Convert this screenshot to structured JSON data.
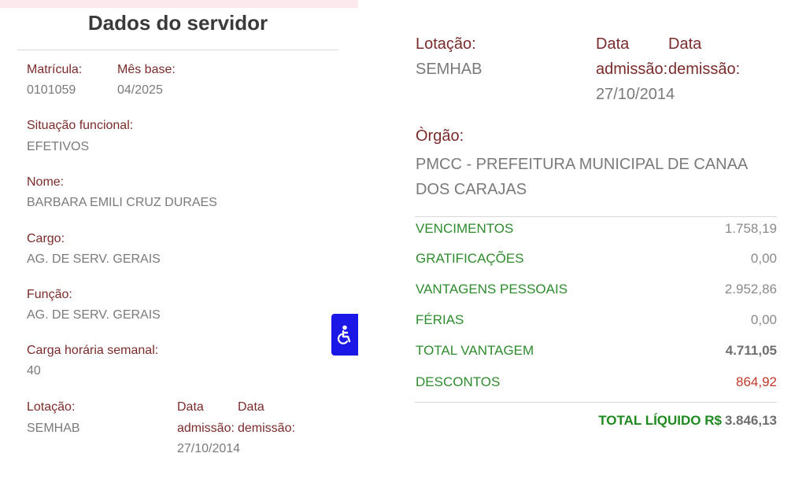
{
  "left": {
    "title": "Dados do servidor",
    "matricula_label": "Matrícula:",
    "matricula_value": "0101059",
    "mes_base_label": "Mês base:",
    "mes_base_value": "04/2025",
    "situacao_label": "Situação funcional:",
    "situacao_value": "EFETIVOS",
    "nome_label": "Nome:",
    "nome_value": "BARBARA EMILI CRUZ DURAES",
    "cargo_label": "Cargo:",
    "cargo_value": "AG. DE SERV. GERAIS",
    "funcao_label": "Função:",
    "funcao_value": "AG. DE SERV. GERAIS",
    "carga_label": "Carga horária semanal:",
    "carga_value": "40",
    "lotacao_label": "Lotação:",
    "lotacao_value": "SEMHAB",
    "data_admissao_label_1": "Data",
    "data_admissao_label_2": "admissão:",
    "data_demissao_label_1": "Data",
    "data_demissao_label_2": "demissão:",
    "data_admissao_value": "27/10/2014"
  },
  "accessibility": {
    "icon": "wheelchair-icon",
    "color": "#1b17e6"
  },
  "right": {
    "lotacao_label": "Lotação:",
    "lotacao_value": "SEMHAB",
    "data_admissao_label_1": "Data",
    "data_admissao_label_2": "admissão:",
    "data_demissao_label_1": "Data",
    "data_demissao_label_2": "demissão:",
    "data_admissao_value": "27/10/2014",
    "orgao_label": "Òrgão:",
    "orgao_value": "PMCC - PREFEITURA MUNICIPAL DE CANAA DOS CARAJAS",
    "rows": [
      {
        "label": "VENCIMENTOS",
        "value": "1.758,19"
      },
      {
        "label": "GRATIFICAÇÕES",
        "value": "0,00"
      },
      {
        "label": "VANTAGENS PESSOAIS",
        "value": "2.952,86"
      },
      {
        "label": "FÉRIAS",
        "value": "0,00"
      },
      {
        "label": "TOTAL VANTAGEM",
        "value": "4.711,05"
      },
      {
        "label": "DESCONTOS",
        "value": "864,92"
      }
    ],
    "total_liquido_label": "TOTAL LÍQUIDO R$",
    "total_liquido_value": "3.846,13"
  },
  "colors": {
    "label_red": "#7a2b2b",
    "value_gray": "#7a7a7a",
    "green": "#2e8b2e",
    "discount_red": "#c0392b"
  }
}
